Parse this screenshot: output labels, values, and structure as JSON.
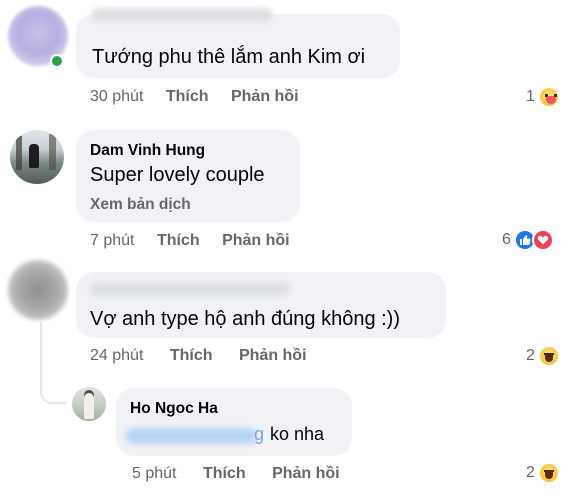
{
  "comments": [
    {
      "author": "",
      "text": "Tướng phu thê lắm anh Kim ơi",
      "time": "30 phút",
      "like_label": "Thích",
      "reply_label": "Phản hồi",
      "reaction_count": "1",
      "reaction_icons": [
        "care-icon"
      ]
    },
    {
      "author": "Dam Vinh Hung",
      "text": "Super lovely couple",
      "see_translation": "Xem bản dịch",
      "time": "7 phút",
      "like_label": "Thích",
      "reply_label": "Phản hồi",
      "reaction_count": "6",
      "reaction_icons": [
        "like-icon",
        "love-icon"
      ]
    },
    {
      "author": "",
      "text": "Vợ anh type hộ anh đúng không :))",
      "time": "24 phút",
      "like_label": "Thích",
      "reply_label": "Phản hồi",
      "reaction_count": "2",
      "reaction_icons": [
        "haha-icon"
      ]
    },
    {
      "author": "Ho Ngoc Ha",
      "mention_tail": "g",
      "text": "ko nha",
      "time": "5 phút",
      "like_label": "Thích",
      "reply_label": "Phản hồi",
      "reaction_count": "2",
      "reaction_icons": [
        "haha-icon"
      ]
    }
  ],
  "colors": {
    "bubble": "#f0f2f5",
    "meta_text": "#65676b",
    "like_blue": "#1877f2",
    "love_red": "#f33e58",
    "online_green": "#31a24c"
  }
}
